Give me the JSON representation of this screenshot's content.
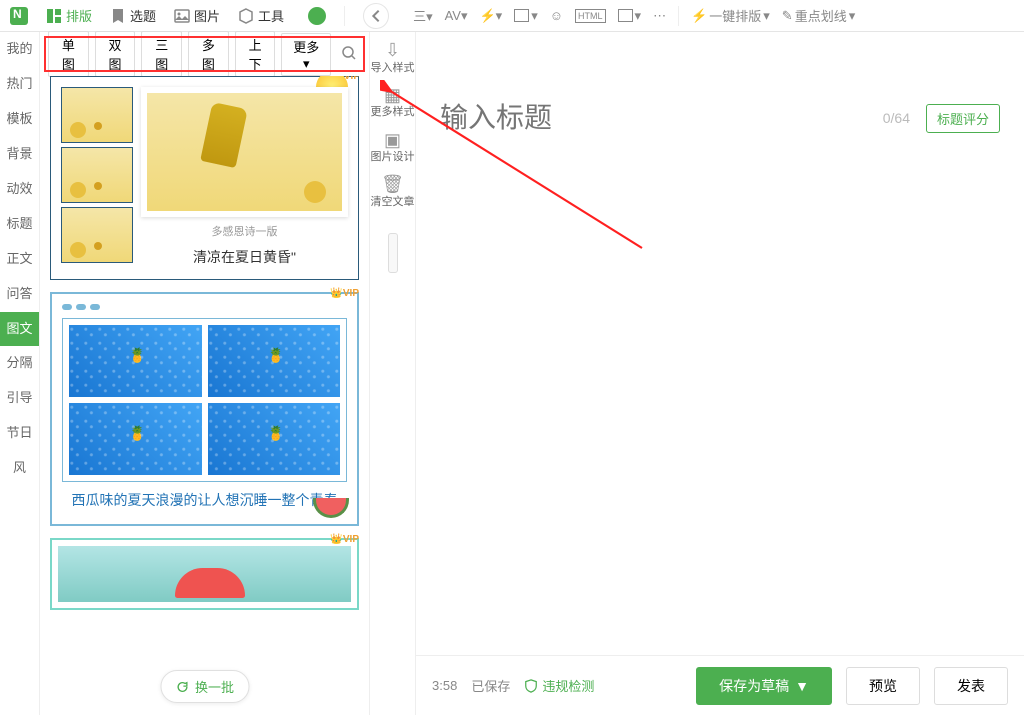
{
  "topnav": {
    "items": [
      {
        "label": "排版"
      },
      {
        "label": "选题"
      },
      {
        "label": "图片"
      },
      {
        "label": "工具"
      }
    ],
    "auto_layout": "一键排版",
    "highlight": "重点划线"
  },
  "sidebar": {
    "tabs": [
      {
        "label": "我的"
      },
      {
        "label": "热门"
      },
      {
        "label": "模板"
      },
      {
        "label": "背景"
      },
      {
        "label": "动效"
      },
      {
        "label": "标题"
      },
      {
        "label": "正文"
      },
      {
        "label": "问答"
      },
      {
        "label": "图文"
      },
      {
        "label": "分隔"
      },
      {
        "label": "引导"
      },
      {
        "label": "节日"
      },
      {
        "label": "风"
      }
    ]
  },
  "filters": [
    "单图",
    "双图",
    "三图",
    "多图",
    "上下",
    "更多 ▾"
  ],
  "templates": {
    "vip": "VIP",
    "card1_caption_top": "多感恩诗一版",
    "card1_caption": "清凉在夏日黄昏\"",
    "card2_caption": "西瓜味的夏天浪漫的让人想沉睡一整个青春",
    "refresh": "换一批"
  },
  "toolcol": [
    "导入样式",
    "更多样式",
    "图片设计",
    "清空文章"
  ],
  "editor": {
    "title_placeholder": "输入标题",
    "title_count": "0/64",
    "score": "标题评分"
  },
  "footer": {
    "time": "3:58",
    "saved": "已保存",
    "violation": "违规检测",
    "save_draft": "保存为草稿",
    "preview": "预览",
    "publish": "发表"
  }
}
